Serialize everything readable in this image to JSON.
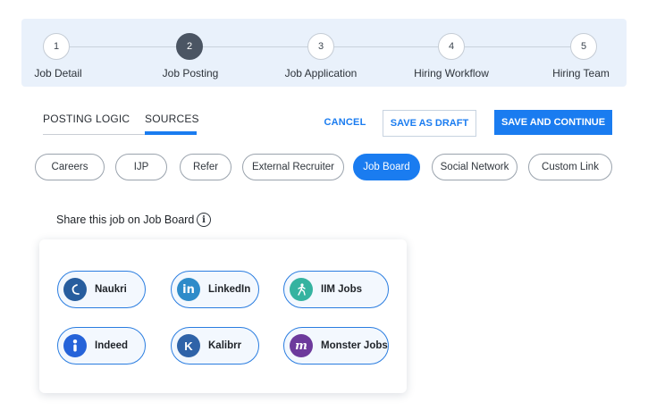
{
  "stepper": {
    "steps": [
      {
        "number": "1",
        "label": "Job Detail"
      },
      {
        "number": "2",
        "label": "Job Posting"
      },
      {
        "number": "3",
        "label": "Job Application"
      },
      {
        "number": "4",
        "label": "Hiring Workflow"
      },
      {
        "number": "5",
        "label": "Hiring Team"
      }
    ],
    "active_step": 2
  },
  "tabs": [
    {
      "label": "POSTING LOGIC",
      "active": false
    },
    {
      "label": "SOURCES",
      "active": true
    }
  ],
  "actions": {
    "cancel_label": "CANCEL",
    "draft_label": "SAVE AS DRAFT",
    "save_label": "SAVE AND CONTINUE"
  },
  "sources": [
    {
      "label": "Careers",
      "active": false
    },
    {
      "label": "IJP",
      "active": false
    },
    {
      "label": "Refer",
      "active": false
    },
    {
      "label": "External Recruiter",
      "active": false
    },
    {
      "label": "Job Board",
      "active": true
    },
    {
      "label": "Social Network",
      "active": false
    },
    {
      "label": "Custom Link",
      "active": false
    }
  ],
  "share": {
    "label": "Share this job on Job Board",
    "info_icon": "info-icon"
  },
  "job_boards": [
    {
      "label": "Naukri",
      "icon": "naukri-logo-icon",
      "color": "#275d9e"
    },
    {
      "label": "LinkedIn",
      "icon": "linkedin-logo-icon",
      "color": "#2e8bc9"
    },
    {
      "label": "IIM Jobs",
      "icon": "iimjobs-logo-icon",
      "color": "#35b3a0"
    },
    {
      "label": "Indeed",
      "icon": "indeed-logo-icon",
      "color": "#2563d9"
    },
    {
      "label": "Kalibrr",
      "icon": "kalibrr-logo-icon",
      "color": "#2f63a8"
    },
    {
      "label": "Monster Jobs",
      "icon": "monster-logo-icon",
      "color": "#6d3a9c"
    }
  ],
  "colors": {
    "accent": "#1a7cf0",
    "stepper_bg": "#e9f1fb",
    "active_step": "#4b5563"
  }
}
